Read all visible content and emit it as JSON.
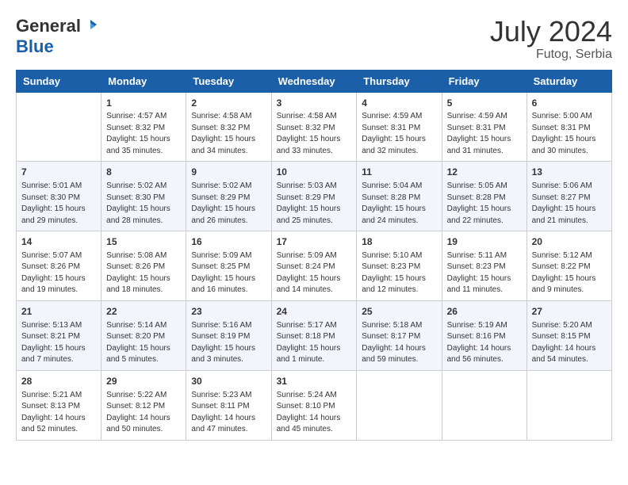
{
  "header": {
    "logo_general": "General",
    "logo_blue": "Blue",
    "month_year": "July 2024",
    "location": "Futog, Serbia"
  },
  "days_of_week": [
    "Sunday",
    "Monday",
    "Tuesday",
    "Wednesday",
    "Thursday",
    "Friday",
    "Saturday"
  ],
  "weeks": [
    [
      {
        "day": "",
        "info": ""
      },
      {
        "day": "1",
        "info": "Sunrise: 4:57 AM\nSunset: 8:32 PM\nDaylight: 15 hours\nand 35 minutes."
      },
      {
        "day": "2",
        "info": "Sunrise: 4:58 AM\nSunset: 8:32 PM\nDaylight: 15 hours\nand 34 minutes."
      },
      {
        "day": "3",
        "info": "Sunrise: 4:58 AM\nSunset: 8:32 PM\nDaylight: 15 hours\nand 33 minutes."
      },
      {
        "day": "4",
        "info": "Sunrise: 4:59 AM\nSunset: 8:31 PM\nDaylight: 15 hours\nand 32 minutes."
      },
      {
        "day": "5",
        "info": "Sunrise: 4:59 AM\nSunset: 8:31 PM\nDaylight: 15 hours\nand 31 minutes."
      },
      {
        "day": "6",
        "info": "Sunrise: 5:00 AM\nSunset: 8:31 PM\nDaylight: 15 hours\nand 30 minutes."
      }
    ],
    [
      {
        "day": "7",
        "info": "Sunrise: 5:01 AM\nSunset: 8:30 PM\nDaylight: 15 hours\nand 29 minutes."
      },
      {
        "day": "8",
        "info": "Sunrise: 5:02 AM\nSunset: 8:30 PM\nDaylight: 15 hours\nand 28 minutes."
      },
      {
        "day": "9",
        "info": "Sunrise: 5:02 AM\nSunset: 8:29 PM\nDaylight: 15 hours\nand 26 minutes."
      },
      {
        "day": "10",
        "info": "Sunrise: 5:03 AM\nSunset: 8:29 PM\nDaylight: 15 hours\nand 25 minutes."
      },
      {
        "day": "11",
        "info": "Sunrise: 5:04 AM\nSunset: 8:28 PM\nDaylight: 15 hours\nand 24 minutes."
      },
      {
        "day": "12",
        "info": "Sunrise: 5:05 AM\nSunset: 8:28 PM\nDaylight: 15 hours\nand 22 minutes."
      },
      {
        "day": "13",
        "info": "Sunrise: 5:06 AM\nSunset: 8:27 PM\nDaylight: 15 hours\nand 21 minutes."
      }
    ],
    [
      {
        "day": "14",
        "info": "Sunrise: 5:07 AM\nSunset: 8:26 PM\nDaylight: 15 hours\nand 19 minutes."
      },
      {
        "day": "15",
        "info": "Sunrise: 5:08 AM\nSunset: 8:26 PM\nDaylight: 15 hours\nand 18 minutes."
      },
      {
        "day": "16",
        "info": "Sunrise: 5:09 AM\nSunset: 8:25 PM\nDaylight: 15 hours\nand 16 minutes."
      },
      {
        "day": "17",
        "info": "Sunrise: 5:09 AM\nSunset: 8:24 PM\nDaylight: 15 hours\nand 14 minutes."
      },
      {
        "day": "18",
        "info": "Sunrise: 5:10 AM\nSunset: 8:23 PM\nDaylight: 15 hours\nand 12 minutes."
      },
      {
        "day": "19",
        "info": "Sunrise: 5:11 AM\nSunset: 8:23 PM\nDaylight: 15 hours\nand 11 minutes."
      },
      {
        "day": "20",
        "info": "Sunrise: 5:12 AM\nSunset: 8:22 PM\nDaylight: 15 hours\nand 9 minutes."
      }
    ],
    [
      {
        "day": "21",
        "info": "Sunrise: 5:13 AM\nSunset: 8:21 PM\nDaylight: 15 hours\nand 7 minutes."
      },
      {
        "day": "22",
        "info": "Sunrise: 5:14 AM\nSunset: 8:20 PM\nDaylight: 15 hours\nand 5 minutes."
      },
      {
        "day": "23",
        "info": "Sunrise: 5:16 AM\nSunset: 8:19 PM\nDaylight: 15 hours\nand 3 minutes."
      },
      {
        "day": "24",
        "info": "Sunrise: 5:17 AM\nSunset: 8:18 PM\nDaylight: 15 hours\nand 1 minute."
      },
      {
        "day": "25",
        "info": "Sunrise: 5:18 AM\nSunset: 8:17 PM\nDaylight: 14 hours\nand 59 minutes."
      },
      {
        "day": "26",
        "info": "Sunrise: 5:19 AM\nSunset: 8:16 PM\nDaylight: 14 hours\nand 56 minutes."
      },
      {
        "day": "27",
        "info": "Sunrise: 5:20 AM\nSunset: 8:15 PM\nDaylight: 14 hours\nand 54 minutes."
      }
    ],
    [
      {
        "day": "28",
        "info": "Sunrise: 5:21 AM\nSunset: 8:13 PM\nDaylight: 14 hours\nand 52 minutes."
      },
      {
        "day": "29",
        "info": "Sunrise: 5:22 AM\nSunset: 8:12 PM\nDaylight: 14 hours\nand 50 minutes."
      },
      {
        "day": "30",
        "info": "Sunrise: 5:23 AM\nSunset: 8:11 PM\nDaylight: 14 hours\nand 47 minutes."
      },
      {
        "day": "31",
        "info": "Sunrise: 5:24 AM\nSunset: 8:10 PM\nDaylight: 14 hours\nand 45 minutes."
      },
      {
        "day": "",
        "info": ""
      },
      {
        "day": "",
        "info": ""
      },
      {
        "day": "",
        "info": ""
      }
    ]
  ]
}
